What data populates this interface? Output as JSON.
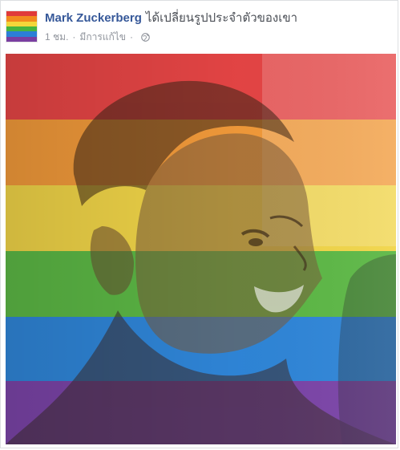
{
  "post": {
    "author": "Mark Zuckerberg",
    "action": "ได้เปลี่ยนรูปประจำตัวของเขา",
    "time": "1 ชม.",
    "separator": "·",
    "edited": "มีการแก้ไข",
    "privacy_icon": "globe-icon"
  },
  "photo": {
    "stripe_colors": [
      "#e03a3a",
      "#f28a1e",
      "#f4d63a",
      "#46b43f",
      "#2b7fd6",
      "#7a3ea1"
    ]
  }
}
